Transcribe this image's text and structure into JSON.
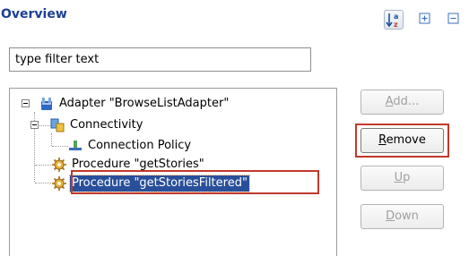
{
  "header": {
    "title": "Overview"
  },
  "toolbar": {
    "sort_icon": "sort-alpha-icon",
    "expand_icon": "expand-all-icon",
    "collapse_icon": "collapse-all-icon"
  },
  "filter": {
    "value": "type filter text"
  },
  "tree": {
    "items": [
      {
        "label": "Adapter \"BrowseListAdapter\"",
        "icon": "adapter-icon",
        "expanded": true
      },
      {
        "label": "Connectivity",
        "icon": "connectivity-icon",
        "expanded": true
      },
      {
        "label": "Connection Policy",
        "icon": "connection-policy-icon"
      },
      {
        "label": "Procedure \"getStories\"",
        "icon": "procedure-icon"
      },
      {
        "label": "Procedure \"getStoriesFiltered\"",
        "icon": "procedure-icon",
        "selected": true
      }
    ]
  },
  "buttons": {
    "add": {
      "mnemonic": "A",
      "rest": "dd...",
      "enabled": false
    },
    "remove": {
      "mnemonic": "R",
      "rest": "emove",
      "enabled": true
    },
    "up": {
      "mnemonic": "U",
      "rest": "p",
      "enabled": false
    },
    "down": {
      "mnemonic": "D",
      "rest": "own",
      "enabled": false
    }
  },
  "colors": {
    "title": "#1c3f94",
    "selection": "#2a4f9a",
    "highlight_border": "#c0392b"
  }
}
